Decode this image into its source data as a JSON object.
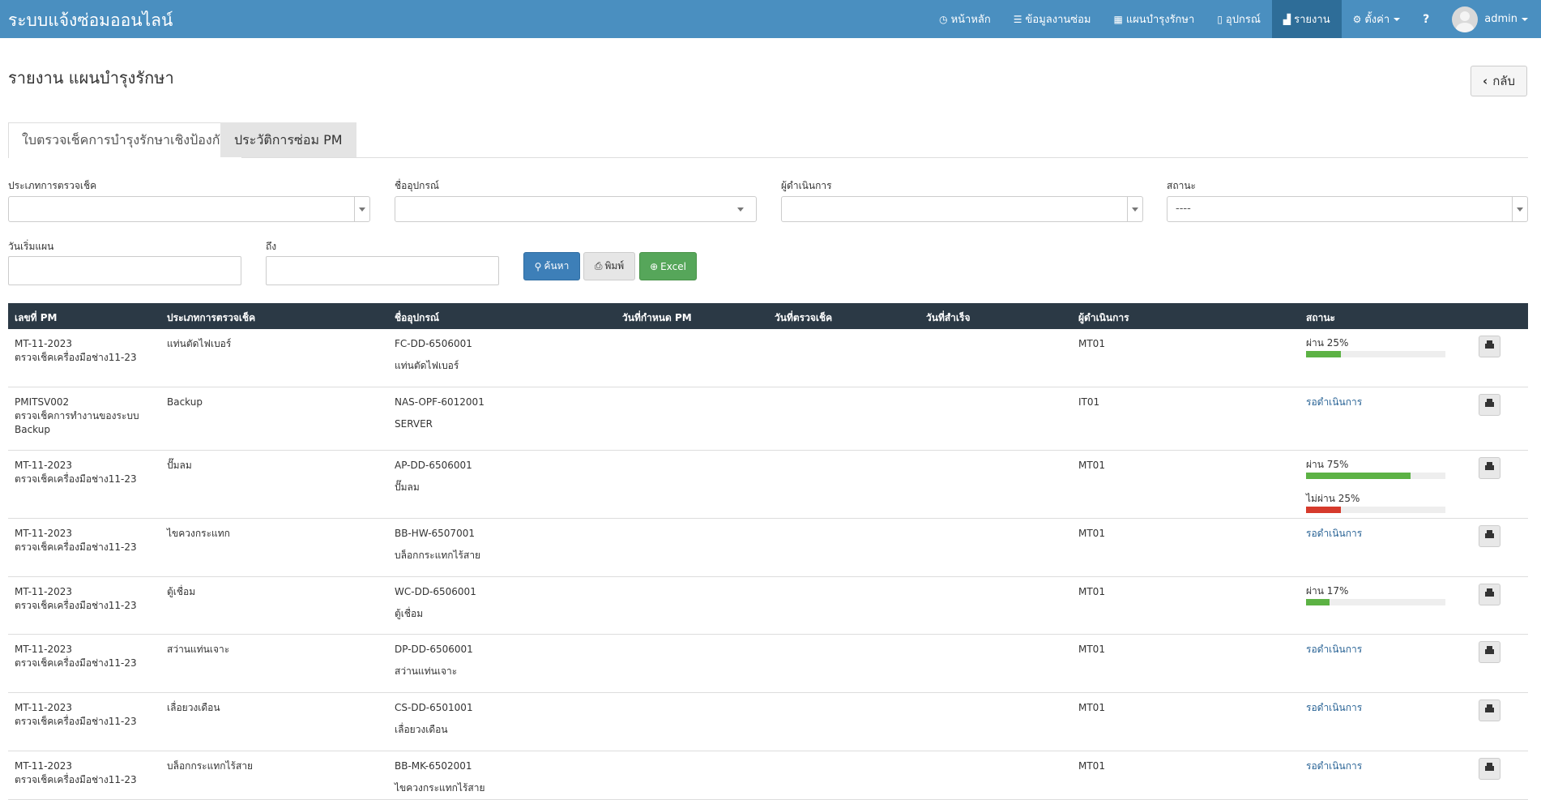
{
  "app": {
    "title": "ระบบแจ้งซ่อมออนไลน์"
  },
  "nav": {
    "items": [
      {
        "label": "หน้าหลัก",
        "icon": "clock-icon"
      },
      {
        "label": "ข้อมูลงานซ่อม",
        "icon": "list-icon"
      },
      {
        "label": "แผนบำรุงรักษา",
        "icon": "calendar-icon"
      },
      {
        "label": "อุปกรณ์",
        "icon": "tablet-icon"
      },
      {
        "label": "รายงาน",
        "icon": "bar-chart-icon",
        "active": true
      },
      {
        "label": "ตั้งค่า",
        "icon": "gear-icon"
      }
    ],
    "help_icon": "?",
    "user": "admin"
  },
  "page": {
    "title": "รายงาน แผนบำรุงรักษา",
    "back_label": "กลับ"
  },
  "tabs": [
    {
      "label": "ใบตรวจเช็คการบำรุงรักษาเชิงป้องกัน",
      "active": true
    },
    {
      "label": "ประวัติการซ่อม PM",
      "active": false
    }
  ],
  "filters": {
    "check_type_label": "ประเภทการตรวจเช็ค",
    "equipment_label": "ชื่ออุปกรณ์",
    "operator_label": "ผู้ดำเนินการ",
    "status_label": "สถานะ",
    "status_value": "----",
    "start_date_label": "วันเริ่มแผน",
    "to_label": "ถึง",
    "search_label": "ค้นหา",
    "print_label": "พิมพ์",
    "excel_label": "Excel"
  },
  "table": {
    "headers": [
      "เลขที่ PM",
      "ประเภทการตรวจเช็ค",
      "ชื่ออุปกรณ์",
      "วันที่กำหนด PM",
      "วันที่ตรวจเช็ค",
      "วันที่สำเร็จ",
      "ผู้ดำเนินการ",
      "สถานะ"
    ],
    "rows": [
      {
        "pm_no": "MT-11-2023",
        "pm_desc": "ตรวจเช็คเครื่องมือช่าง11-23",
        "check_type": "แท่นตัดไฟเบอร์",
        "equip_code": "FC-DD-6506001",
        "equip_name": "แท่นตัดไฟเบอร์",
        "operator": "MT01",
        "status": {
          "bars": [
            {
              "label": "ผ่าน 25%",
              "pct": 25,
              "color": "#5cb244"
            }
          ]
        }
      },
      {
        "pm_no": "PMITSV002",
        "pm_desc": "ตรวจเช็คการทำงานของระบบ Backup",
        "check_type": "Backup",
        "equip_code": "NAS-OPF-6012001",
        "equip_name": "SERVER",
        "operator": "IT01",
        "status": {
          "text": "รอดำเนินการ"
        }
      },
      {
        "pm_no": "MT-11-2023",
        "pm_desc": "ตรวจเช็คเครื่องมือช่าง11-23",
        "check_type": "ปั๊มลม",
        "equip_code": "AP-DD-6506001",
        "equip_name": "ปั๊มลม",
        "operator": "MT01",
        "status": {
          "bars": [
            {
              "label": "ผ่าน 75%",
              "pct": 75,
              "color": "#5cb244"
            },
            {
              "label": "ไม่ผ่าน 25%",
              "pct": 25,
              "color": "#d63a2c"
            }
          ]
        }
      },
      {
        "pm_no": "MT-11-2023",
        "pm_desc": "ตรวจเช็คเครื่องมือช่าง11-23",
        "check_type": "ไขควงกระแทก",
        "equip_code": "BB-HW-6507001",
        "equip_name": "บล็อกกระแทกไร้สาย",
        "operator": "MT01",
        "status": {
          "text": "รอดำเนินการ"
        }
      },
      {
        "pm_no": "MT-11-2023",
        "pm_desc": "ตรวจเช็คเครื่องมือช่าง11-23",
        "check_type": "ตู้เชื่อม",
        "equip_code": "WC-DD-6506001",
        "equip_name": "ตู้เชื่อม",
        "operator": "MT01",
        "status": {
          "bars": [
            {
              "label": "ผ่าน 17%",
              "pct": 17,
              "color": "#5cb244"
            }
          ]
        }
      },
      {
        "pm_no": "MT-11-2023",
        "pm_desc": "ตรวจเช็คเครื่องมือช่าง11-23",
        "check_type": "สว่านแท่นเจาะ",
        "equip_code": "DP-DD-6506001",
        "equip_name": "สว่านแท่นเจาะ",
        "operator": "MT01",
        "status": {
          "text": "รอดำเนินการ"
        }
      },
      {
        "pm_no": "MT-11-2023",
        "pm_desc": "ตรวจเช็คเครื่องมือช่าง11-23",
        "check_type": "เลื่อยวงเดือน",
        "equip_code": "CS-DD-6501001",
        "equip_name": "เลื่อยวงเดือน",
        "operator": "MT01",
        "status": {
          "text": "รอดำเนินการ"
        }
      },
      {
        "pm_no": "MT-11-2023",
        "pm_desc": "ตรวจเช็คเครื่องมือช่าง11-23",
        "check_type": "บล็อกกระแทกไร้สาย",
        "equip_code": "BB-MK-6502001",
        "equip_name": "ไขควงกระแทกไร้สาย",
        "operator": "MT01",
        "status": {
          "text": "รอดำเนินการ"
        }
      }
    ]
  }
}
